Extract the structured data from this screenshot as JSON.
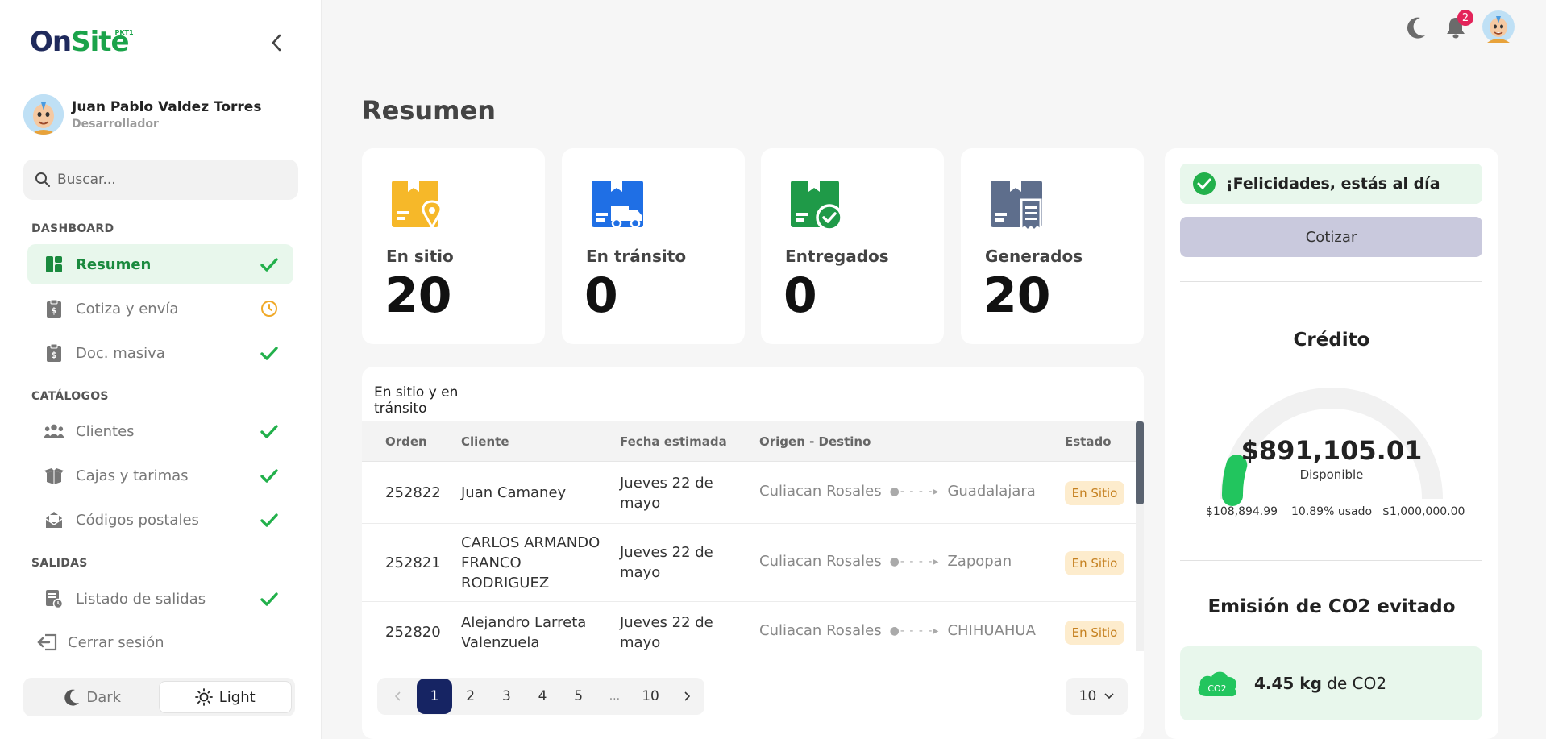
{
  "brand": {
    "logo_on": "On",
    "logo_site": "Site",
    "logo_tag": "PKT1"
  },
  "user": {
    "name": "Juan Pablo Valdez Torres",
    "role": "Desarrollador"
  },
  "search": {
    "placeholder": "Buscar..."
  },
  "sidebar": {
    "sections": [
      {
        "label": "DASHBOARD"
      },
      {
        "label": "CATÁLOGOS"
      },
      {
        "label": "SALIDAS"
      }
    ],
    "items": [
      {
        "label": "Resumen",
        "status": "done",
        "active": true
      },
      {
        "label": "Cotiza y envía",
        "status": "pending"
      },
      {
        "label": "Doc. masiva",
        "status": "done"
      },
      {
        "label": "Clientes",
        "status": "done"
      },
      {
        "label": "Cajas y tarimas",
        "status": "done"
      },
      {
        "label": "Códigos postales",
        "status": "done"
      },
      {
        "label": "Listado de salidas",
        "status": "done"
      }
    ],
    "logout": "Cerrar sesión",
    "theme": {
      "dark": "Dark",
      "light": "Light",
      "selected": "light"
    }
  },
  "topbar": {
    "notifications": "2"
  },
  "page": {
    "title": "Resumen"
  },
  "stats": [
    {
      "label": "En sitio",
      "value": "20",
      "color": "#f6b829"
    },
    {
      "label": "En tránsito",
      "value": "0",
      "color": "#1f6fe5"
    },
    {
      "label": "Entregados",
      "value": "0",
      "color": "#1f9a48"
    },
    {
      "label": "Generados",
      "value": "20",
      "color": "#5e6e8c"
    }
  ],
  "table": {
    "tab": "En sitio y en tránsito",
    "headers": {
      "orden": "Orden",
      "cliente": "Cliente",
      "fecha": "Fecha estimada",
      "ruta": "Origen - Destino",
      "estado": "Estado"
    },
    "rows": [
      {
        "orden": "252822",
        "cliente": "Juan Camaney",
        "fecha": "Jueves 22 de mayo",
        "origen": "Culiacan Rosales",
        "destino": "Guadalajara",
        "estado": "En Sitio"
      },
      {
        "orden": "252821",
        "cliente": "CARLOS ARMANDO FRANCO RODRIGUEZ",
        "fecha": "Jueves 22 de mayo",
        "origen": "Culiacan Rosales",
        "destino": "Zapopan",
        "estado": "En Sitio"
      },
      {
        "orden": "252820",
        "cliente": "Alejandro Larreta Valenzuela",
        "fecha": "Jueves 22 de mayo",
        "origen": "Culiacan Rosales",
        "destino": "CHIHUAHUA",
        "estado": "En Sitio"
      }
    ],
    "pagination": {
      "pages": [
        "1",
        "2",
        "3",
        "4",
        "5",
        "...",
        "10"
      ],
      "current": "1",
      "page_size": "10"
    }
  },
  "panel": {
    "alert": "¡Felicidades, estás al día",
    "quote_button": "Cotizar",
    "credit": {
      "title": "Crédito",
      "available": "$891,105.01",
      "available_label": "Disponible",
      "used": "$108,894.99",
      "used_pct": "10.89% usado",
      "used_fraction": 0.1089,
      "limit": "$1,000,000.00"
    },
    "co2": {
      "title": "Emisión de CO2 evitado",
      "amount": "4.45 kg",
      "suffix": " de CO2",
      "icon_label": "CO2"
    }
  },
  "colors": {
    "accent_green": "#1aa34a",
    "navy": "#162463",
    "tab_underline": "#e79a3a"
  }
}
